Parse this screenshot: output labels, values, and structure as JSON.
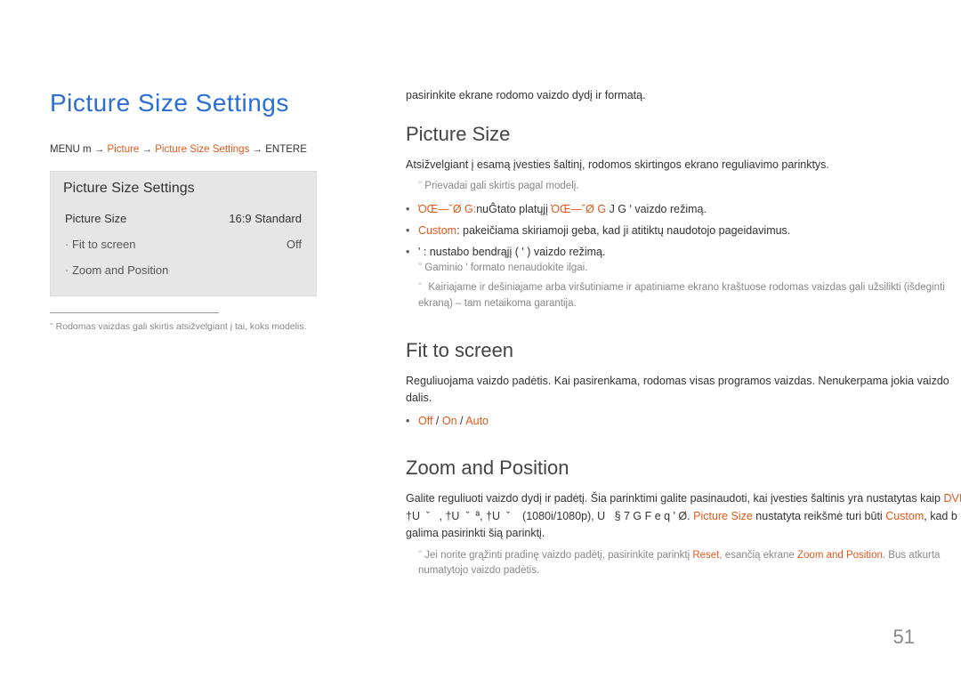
{
  "pageNumber": "51",
  "left": {
    "title": "Picture Size Settings",
    "breadcrumb": {
      "p1": "MENU m → ",
      "p2": "Picture",
      "p3": " → ",
      "p4": "Picture Size Settings",
      "p5": " → ENTERE"
    },
    "panel": {
      "title": "Picture Size Settings",
      "rows": [
        {
          "key": "Picture Size",
          "val": "16:9 Standard",
          "sub": false
        },
        {
          "key": "Fit to screen",
          "val": "Off",
          "sub": true
        },
        {
          "key": "Zoom and Position",
          "val": "",
          "sub": true
        }
      ]
    },
    "footnote": "Rodomas vaizdas gali skirtis atsižvelgiant į tai, koks modelis."
  },
  "right": {
    "intro": "pasirinkite ekrane rodomo vaizdo dydį ir formatą.",
    "sec1": {
      "title": "Picture Size",
      "para": "Atsižvelgiant į esamą įvesties šaltinį, rodomos skirtingos ekrano reguliavimo parinktys.",
      "note1": "Prievadai gali skirtis pagal modelį.",
      "bullets": [
        {
          "lead": "ΌŒ—˘Ø G:",
          "text1": "nuĜtato platųjį ",
          "em1": "ΌŒ—˘Ø G",
          "text2": " J G ' vaizdo režimą.",
          "orangeLead": true
        },
        {
          "lead": "Custom",
          "text1": ": pakeičiama skiriamoji geba, kad ji atitiktų naudotojo pageidavimus.",
          "orangeLead": true
        },
        {
          "lead": "'",
          "text1": "   : nustabo bendrąjį (    ' ) vaizdo režimą.",
          "orangeLead": false
        }
      ],
      "subnote1_a": "Gaminio ",
      "subnote1_b": "'",
      "subnote1_c": " formato nenaudokite ilgai.",
      "subnote2": "Kairiajame ir dešiniajame arba viršutiniame ir apatiniame ekrano kraštuose rodomas vaizdas gali užsilikti (išdeginti ekraną) – tam netaikoma garantija."
    },
    "sec2": {
      "title": "Fit to screen",
      "para": "Reguliuojama vaizdo padėtis. Kai pasirenkama, rodomas visas programos vaizdas. Nenukerpama jokia vaizdo dalis.",
      "opts": {
        "a": "Off",
        "b": "On",
        "c": "Auto"
      }
    },
    "sec3": {
      "title": "Zoom and Position",
      "para_a": "Galite reguliuoti vaizdo dydį ir padėtį. Šia parinktimi galite pasinaudoti, kai įvesties šaltinis yra nustatytas kaip ",
      "para_b": "DVI",
      "para_c": ", †U  ˇ   , †U  ˇ  ª, †U  ˇ    (1080i/1080p),  U   § 7 G F e q ' Ø. ",
      "para_d": "Picture Size",
      "para_e": " nustatyta reikšmė turi būti ",
      "para_f": "Custom",
      "para_g": ", kad b galima pasirinkti šią parinktį.",
      "note_a": "Jei norite grąžinti pradinę vaizdo padėtį, pasirinkite parinktį ",
      "note_b": "Reset",
      "note_c": ", esančią ekrane ",
      "note_d": "Zoom and Position",
      "note_e": ". Bus atkurta numatytojo vaizdo padėtis."
    }
  }
}
